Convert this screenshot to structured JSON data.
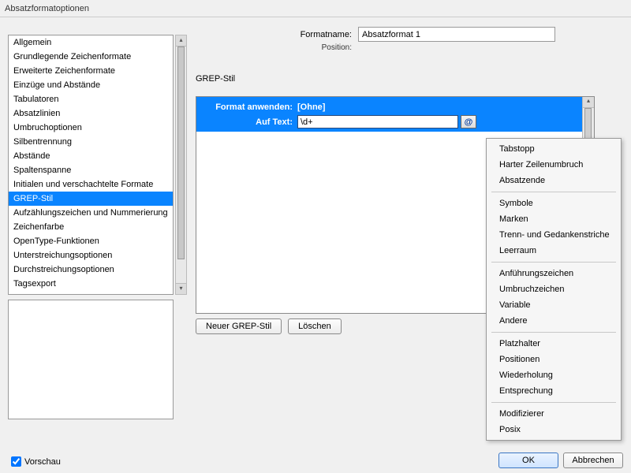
{
  "window": {
    "title": "Absatzformatoptionen"
  },
  "sidebar": {
    "items": [
      "Allgemein",
      "Grundlegende Zeichenformate",
      "Erweiterte Zeichenformate",
      "Einzüge und Abstände",
      "Tabulatoren",
      "Absatzlinien",
      "Umbruchoptionen",
      "Silbentrennung",
      "Abstände",
      "Spaltenspanne",
      "Initialen und verschachtelte Formate",
      "GREP-Stil",
      "Aufzählungszeichen und Nummerierung",
      "Zeichenfarbe",
      "OpenType-Funktionen",
      "Unterstreichungsoptionen",
      "Durchstreichungsoptionen",
      "Tagsexport"
    ],
    "selected_index": 11
  },
  "header": {
    "formatname_label": "Formatname:",
    "formatname_value": "Absatzformat 1",
    "position_label": "Position:"
  },
  "grep": {
    "section_title": "GREP-Stil",
    "apply_label": "Format anwenden:",
    "apply_value": "[Ohne]",
    "text_label": "Auf Text:",
    "text_value": "\\d+",
    "at_icon": "@",
    "new_button": "Neuer GREP-Stil",
    "delete_button": "Löschen"
  },
  "context_menu": {
    "groups": [
      [
        "Tabstopp",
        "Harter Zeilenumbruch",
        "Absatzende"
      ],
      [
        "Symbole",
        "Marken",
        "Trenn- und Gedankenstriche",
        "Leerraum"
      ],
      [
        "Anführungszeichen",
        "Umbruchzeichen",
        "Variable",
        "Andere"
      ],
      [
        "Platzhalter",
        "Positionen",
        "Wiederholung",
        "Entsprechung"
      ],
      [
        "Modifizierer",
        "Posix"
      ]
    ]
  },
  "footer": {
    "preview_label": "Vorschau",
    "preview_checked": true,
    "ok": "OK",
    "cancel": "Abbrechen"
  }
}
